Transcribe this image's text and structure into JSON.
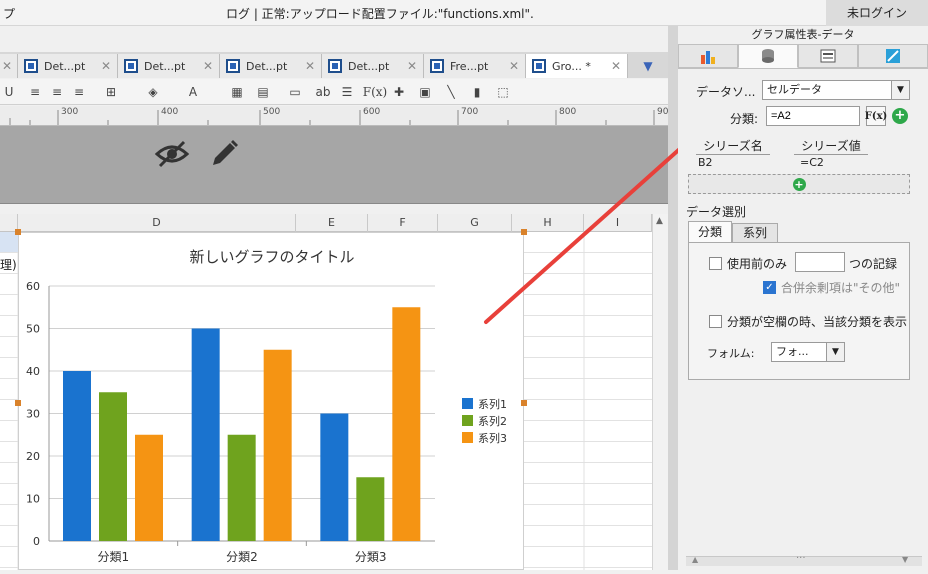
{
  "titlebar": {
    "left_text": "プ",
    "status": "ログ | 正常:アップロード配置ファイル:\"functions.xml\".",
    "login": "未ログイン"
  },
  "tabs": [
    {
      "label": "Det...pt"
    },
    {
      "label": "Det...pt"
    },
    {
      "label": "Det...pt"
    },
    {
      "label": "Det...pt"
    },
    {
      "label": "Fre...pt"
    },
    {
      "label": "Gro... *",
      "active": true
    }
  ],
  "ruler": {
    "labels": [
      "300",
      "400",
      "500",
      "600",
      "700",
      "800",
      "90"
    ]
  },
  "toolbar": {
    "abc_label": "ab",
    "fx_label": "F(x)"
  },
  "columns": [
    "D",
    "E",
    "F",
    "G",
    "H",
    "I"
  ],
  "cell_snippet": "理)",
  "chart_data": {
    "type": "bar",
    "title": "新しいグラフのタイトル",
    "categories": [
      "分類1",
      "分類2",
      "分類3"
    ],
    "series": [
      {
        "name": "系列1",
        "color": "#1a73cf",
        "values": [
          40,
          50,
          30
        ]
      },
      {
        "name": "系列2",
        "color": "#6fa31e",
        "values": [
          35,
          25,
          15
        ]
      },
      {
        "name": "系列3",
        "color": "#f59413",
        "values": [
          25,
          45,
          55
        ]
      }
    ],
    "ylim": [
      0,
      60
    ],
    "yticks": [
      0,
      10,
      20,
      30,
      40,
      50,
      60
    ],
    "grid": true,
    "legend": "right"
  },
  "panel": {
    "title": "グラフ属性表-データ",
    "datasource_label": "データソ...",
    "datasource_value": "セルデータ",
    "category_label": "分類:",
    "category_value": "=A2",
    "fx_button": "F(x)",
    "series_name_header": "シリーズ名",
    "series_value_header": "シリーズ値",
    "series_rows": [
      {
        "name": "B2",
        "value": "=C2"
      }
    ],
    "data_select_label": "データ選別",
    "subtabs": [
      "分類",
      "系列"
    ],
    "use_first_label": "使用前のみ",
    "records_suffix": "つの記録",
    "merge_label": "合併余剰項は\"その他\"",
    "empty_label": "分類が空欄の時、当該分類を表示",
    "formula_label": "フォルム:",
    "formula_value": "フォ..."
  }
}
